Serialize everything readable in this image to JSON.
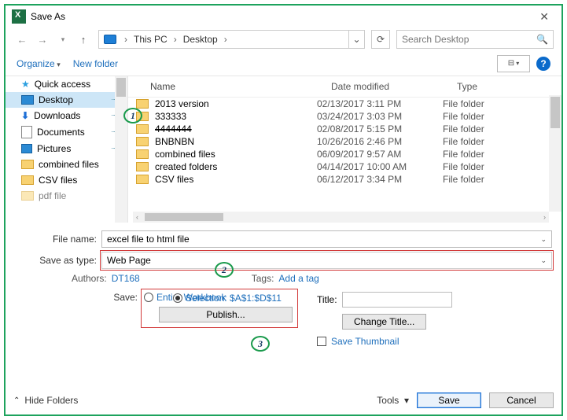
{
  "window": {
    "title": "Save As"
  },
  "nav": {
    "path": [
      "This PC",
      "Desktop"
    ],
    "search_placeholder": "Search Desktop"
  },
  "toolbar": {
    "organize": "Organize",
    "new_folder": "New folder"
  },
  "sidebar": {
    "items": [
      {
        "label": "Quick access",
        "icon": "star"
      },
      {
        "label": "Desktop",
        "icon": "desktop",
        "pinned": true,
        "selected": true
      },
      {
        "label": "Downloads",
        "icon": "download",
        "pinned": true
      },
      {
        "label": "Documents",
        "icon": "docs",
        "pinned": true
      },
      {
        "label": "Pictures",
        "icon": "pics",
        "pinned": true
      },
      {
        "label": "combined files",
        "icon": "folder"
      },
      {
        "label": "CSV files",
        "icon": "folder"
      },
      {
        "label": "pdf file",
        "icon": "folder"
      }
    ]
  },
  "filelist": {
    "columns": [
      "Name",
      "Date modified",
      "Type"
    ],
    "rows": [
      {
        "name": "2013 version",
        "date": "02/13/2017 3:11 PM",
        "type": "File folder"
      },
      {
        "name": "333333",
        "date": "03/24/2017 3:03 PM",
        "type": "File folder"
      },
      {
        "name": "4444444",
        "date": "02/08/2017 5:15 PM",
        "type": "File folder",
        "strike": true
      },
      {
        "name": "BNBNBN",
        "date": "10/26/2016 2:46 PM",
        "type": "File folder"
      },
      {
        "name": "combined files",
        "date": "06/09/2017 9:57 AM",
        "type": "File folder"
      },
      {
        "name": "created folders",
        "date": "04/14/2017 10:00 AM",
        "type": "File folder"
      },
      {
        "name": "CSV files",
        "date": "06/12/2017 3:34 PM",
        "type": "File folder"
      }
    ]
  },
  "fields": {
    "filename_label": "File name:",
    "filename_value": "excel file to html file",
    "savetype_label": "Save as type:",
    "savetype_value": "Web Page"
  },
  "meta": {
    "authors_label": "Authors:",
    "authors_value": "DT168",
    "tags_label": "Tags:",
    "tags_value": "Add a tag"
  },
  "save": {
    "save_label": "Save:",
    "entire": "Entire Workbook",
    "selection": "Selection: $A$1:$D$11",
    "publish": "Publish...",
    "title_label": "Title:",
    "change_title": "Change Title...",
    "save_thumb": "Save Thumbnail"
  },
  "footer": {
    "hide_folders": "Hide Folders",
    "tools": "Tools",
    "save": "Save",
    "cancel": "Cancel"
  },
  "markers": {
    "m1": "1",
    "m2": "2",
    "m3": "3"
  }
}
